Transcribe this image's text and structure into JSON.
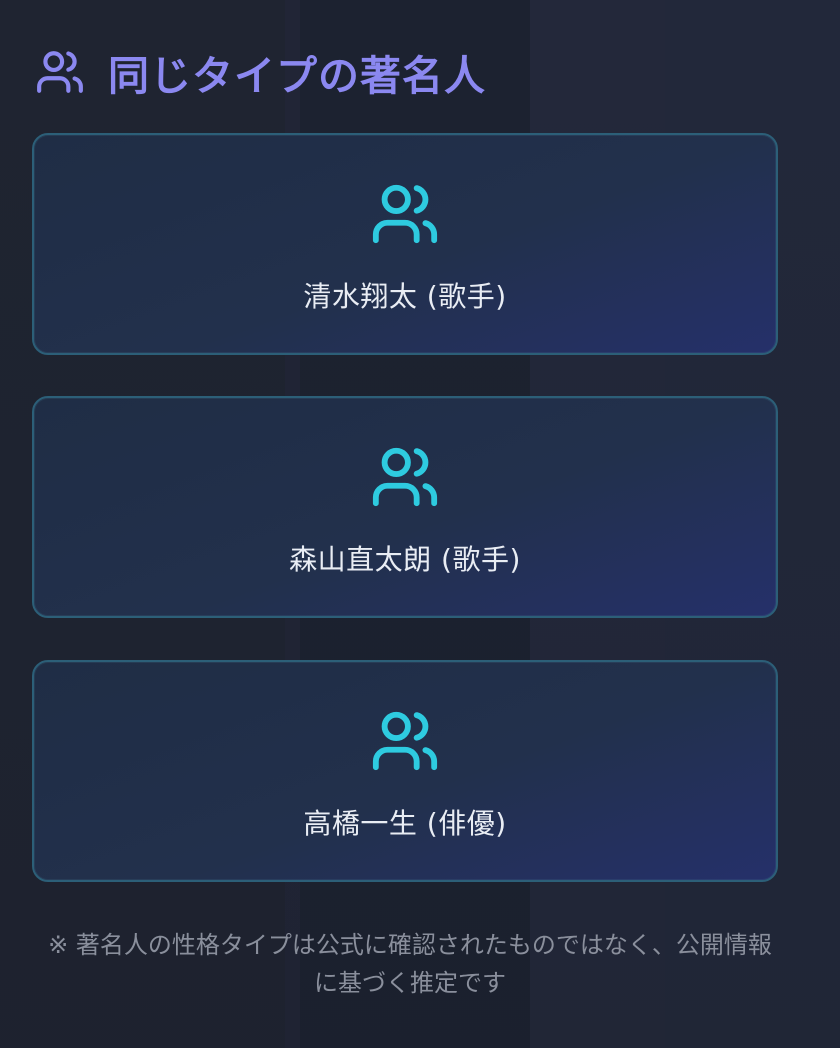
{
  "header": {
    "icon": "users-icon",
    "title": "同じタイプの著名人"
  },
  "celebrities": [
    {
      "icon": "users-icon",
      "name": "清水翔太 (歌手)"
    },
    {
      "icon": "users-icon",
      "name": "森山直太朗 (歌手)"
    },
    {
      "icon": "users-icon",
      "name": "高橋一生 (俳優)"
    }
  ],
  "note": "※ 著名人の性格タイプは公式に確認されたものではなく、公開情報に基づく推定です",
  "colors": {
    "title": "#8b88f0",
    "card_icon": "#2ecbe0",
    "card_border": "#2c5f78",
    "text": "#e9edf4",
    "note": "#8a8f9c"
  }
}
